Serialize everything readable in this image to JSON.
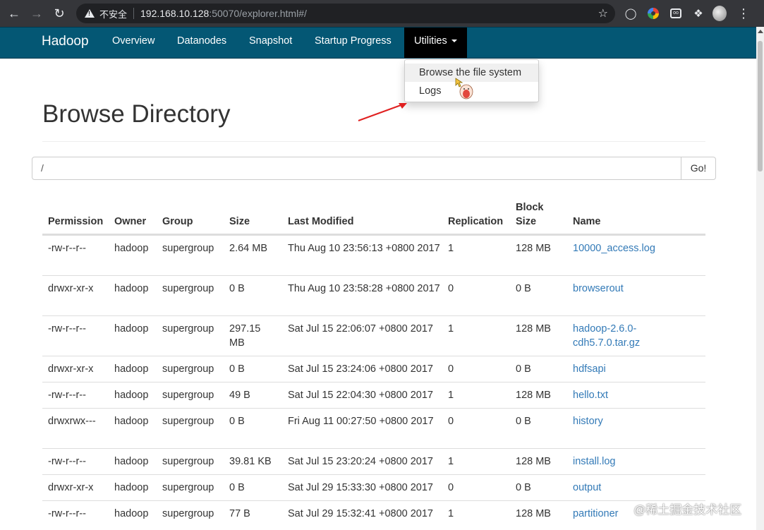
{
  "browser": {
    "security_label": "不安全",
    "url_host": "192.168.10.128",
    "url_rest": ":50070/explorer.html#/"
  },
  "navbar": {
    "brand": "Hadoop",
    "items": [
      "Overview",
      "Datanodes",
      "Snapshot",
      "Startup Progress"
    ],
    "active_item": "Utilities"
  },
  "dropdown": {
    "items": [
      "Browse the file system",
      "Logs"
    ]
  },
  "page": {
    "title": "Browse Directory",
    "path_value": "/",
    "go_label": "Go!"
  },
  "table": {
    "headers": [
      "Permission",
      "Owner",
      "Group",
      "Size",
      "Last Modified",
      "Replication",
      "Block Size",
      "Name"
    ],
    "rows": [
      [
        "-rw-r--r--",
        "hadoop",
        "supergroup",
        "2.64 MB",
        "Thu Aug 10 23:56:13 +0800 2017",
        "1",
        "128 MB",
        "10000_access.log"
      ],
      [
        "drwxr-xr-x",
        "hadoop",
        "supergroup",
        "0 B",
        "Thu Aug 10 23:58:28 +0800 2017",
        "0",
        "0 B",
        "browserout"
      ],
      [
        "-rw-r--r--",
        "hadoop",
        "supergroup",
        "297.15 MB",
        "Sat Jul 15 22:06:07 +0800 2017",
        "1",
        "128 MB",
        "hadoop-2.6.0-cdh5.7.0.tar.gz"
      ],
      [
        "drwxr-xr-x",
        "hadoop",
        "supergroup",
        "0 B",
        "Sat Jul 15 23:24:06 +0800 2017",
        "0",
        "0 B",
        "hdfsapi"
      ],
      [
        "-rw-r--r--",
        "hadoop",
        "supergroup",
        "49 B",
        "Sat Jul 15 22:04:30 +0800 2017",
        "1",
        "128 MB",
        "hello.txt"
      ],
      [
        "drwxrwx---",
        "hadoop",
        "supergroup",
        "0 B",
        "Fri Aug 11 00:27:50 +0800 2017",
        "0",
        "0 B",
        "history"
      ],
      [
        "-rw-r--r--",
        "hadoop",
        "supergroup",
        "39.81 KB",
        "Sat Jul 15 23:20:24 +0800 2017",
        "1",
        "128 MB",
        "install.log"
      ],
      [
        "drwxr-xr-x",
        "hadoop",
        "supergroup",
        "0 B",
        "Sat Jul 29 15:33:30 +0800 2017",
        "0",
        "0 B",
        "output"
      ],
      [
        "-rw-r--r--",
        "hadoop",
        "supergroup",
        "77 B",
        "Sat Jul 29 15:32:41 +0800 2017",
        "1",
        "128 MB",
        "partitioner"
      ]
    ]
  },
  "watermark": "@稀土掘金技术社区",
  "colors": {
    "navbar_bg": "#045774",
    "link": "#337ab7",
    "active_nav_bg": "#000000"
  },
  "icons": [
    "back-arrow-icon",
    "forward-arrow-icon",
    "reload-icon",
    "warning-icon",
    "star-icon",
    "bulb-icon",
    "color-ring-icon",
    "extension-box-icon",
    "puzzle-icon",
    "avatar-icon",
    "kebab-menu-icon",
    "red-arrow-annotation",
    "caret-down-icon"
  ]
}
